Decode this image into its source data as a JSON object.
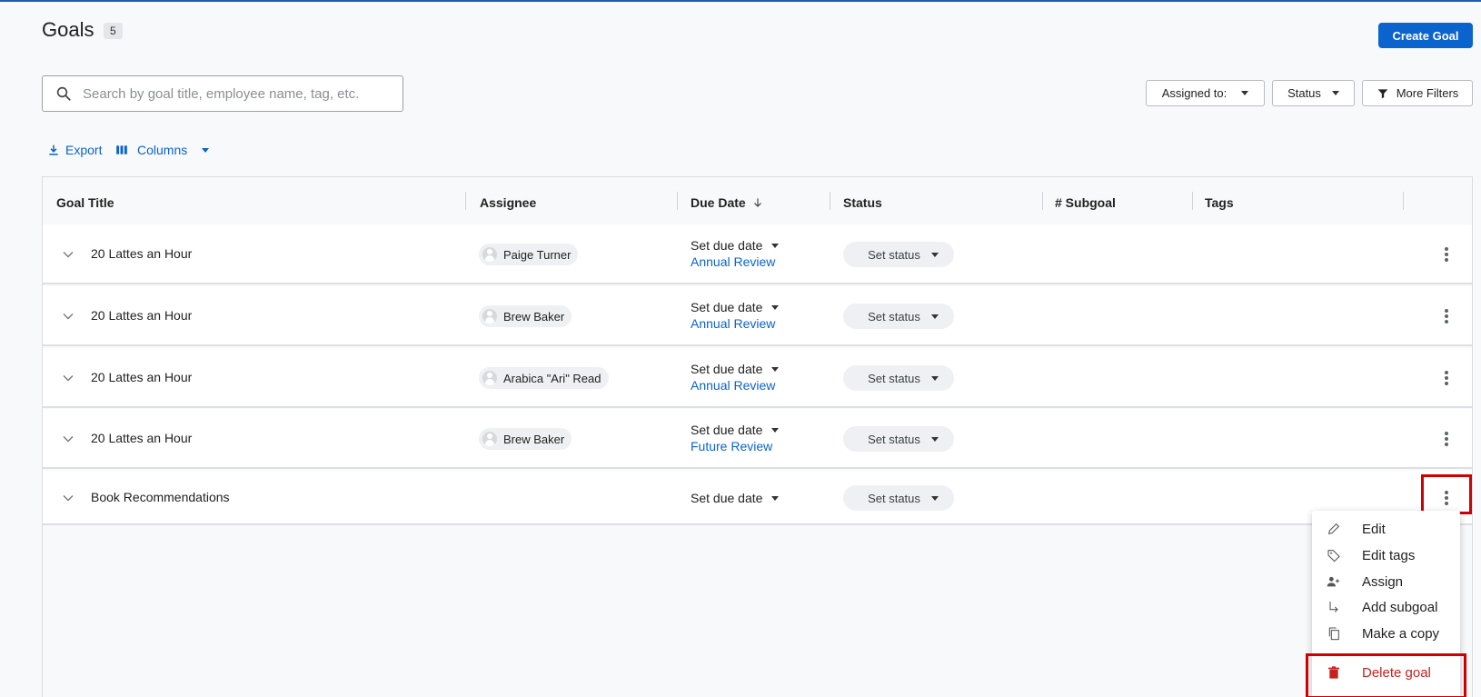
{
  "header": {
    "title": "Goals",
    "count": "5",
    "create_button": "Create Goal"
  },
  "search": {
    "placeholder": "Search by goal title, employee name, tag, etc."
  },
  "filters": {
    "assigned_to": "Assigned to:",
    "status": "Status",
    "more_filters": "More Filters"
  },
  "toolbar": {
    "export": "Export",
    "columns": "Columns"
  },
  "table": {
    "columns": [
      "Goal Title",
      "Assignee",
      "Due Date",
      "Status",
      "# Subgoal",
      "Tags"
    ],
    "rows": [
      {
        "title": "20 Lattes an Hour",
        "assignee": "Paige Turner",
        "due": "Set due date",
        "review": "Annual Review",
        "status": "Set status"
      },
      {
        "title": "20 Lattes an Hour",
        "assignee": "Brew Baker",
        "due": "Set due date",
        "review": "Annual Review",
        "status": "Set status"
      },
      {
        "title": "20 Lattes an Hour",
        "assignee": "Arabica \"Ari\" Read",
        "due": "Set due date",
        "review": "Annual Review",
        "status": "Set status"
      },
      {
        "title": "20 Lattes an Hour",
        "assignee": "Brew Baker",
        "due": "Set due date",
        "review": "Future Review",
        "status": "Set status"
      },
      {
        "title": "Book Recommendations",
        "assignee": "",
        "due": "Set due date",
        "review": "",
        "status": "Set status"
      }
    ]
  },
  "context_menu": {
    "items": [
      {
        "label": "Edit",
        "icon": "pencil-icon"
      },
      {
        "label": "Edit tags",
        "icon": "tag-icon"
      },
      {
        "label": "Assign",
        "icon": "person-add-icon"
      },
      {
        "label": "Add subgoal",
        "icon": "subdirectory-arrow-icon"
      },
      {
        "label": "Make a copy",
        "icon": "copy-icon"
      },
      {
        "label": "Delete goal",
        "icon": "trash-icon"
      }
    ]
  },
  "colors": {
    "accent": "#0b63ce",
    "danger": "#c5221f",
    "highlight": "#d00000"
  }
}
